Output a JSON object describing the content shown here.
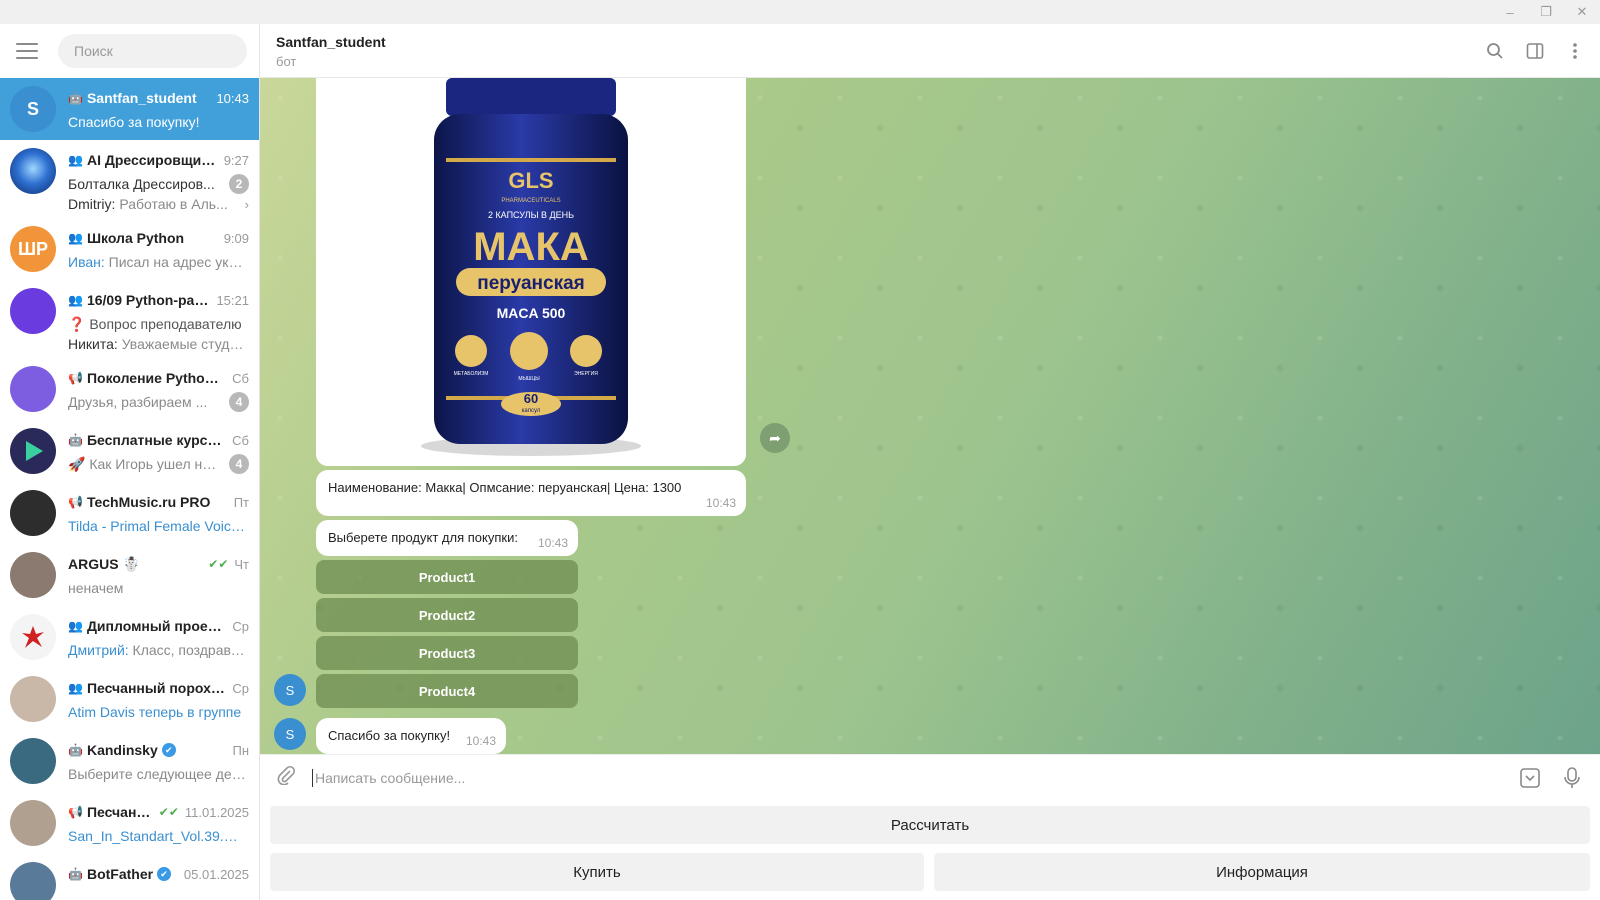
{
  "window": {
    "minimize": "–",
    "restore": "❐",
    "close": "✕"
  },
  "sidebar": {
    "search_placeholder": "Поиск",
    "chats": [
      {
        "type": "🤖",
        "name": "Santfan_student",
        "time": "10:43",
        "message": "Спасибо за покупку!",
        "avatar_letter": "S",
        "avatar_color": "#3a8fd0"
      },
      {
        "type": "👥",
        "name": "AI Дрессировщик...",
        "time": "9:27",
        "message": "Болталка Дрессиров...",
        "badge": "2",
        "avatar_color": "#1f4fa0"
      },
      {
        "type": "👥",
        "name": "Школа Python",
        "time": "9:09",
        "sender": "Иван:",
        "message": "Писал на адрес указа...",
        "avatar_letter": "ШР",
        "avatar_color": "#f2953a"
      },
      {
        "type": "👥",
        "name": "16/09 Python-раз...",
        "time": "15:21",
        "message": "❓ Вопрос преподавателю",
        "avatar_color": "#6a3ce0"
      },
      {
        "type": "📢",
        "name": "Поколение Python 🐍",
        "time": "Сб",
        "message": "Друзья, разбираем ...",
        "badge": "4",
        "avatar_color": "#7d5ee0"
      },
      {
        "type": "🤖",
        "name": "Бесплатные курсы ...",
        "time": "Сб",
        "message": "🚀 Как Игорь ушел на ...",
        "badge": "4",
        "avatar_color": "#2a2a5a"
      },
      {
        "type": "📢",
        "name": "TechMusic.ru PRO",
        "time": "Пт",
        "message": "Tilda - Primal Female Voice 1....",
        "avatar_color": "#2d2d2d"
      },
      {
        "type": "",
        "name": "ARGUS ☃️",
        "time": "Чт",
        "message": "неначем",
        "checks": "✔✔",
        "avatar_color": "#8a7a70"
      },
      {
        "type": "👥",
        "name": "Дипломный проект...",
        "time": "Ср",
        "sender": "Дмитрий:",
        "message": "Класс, поздравля...",
        "avatar_color": "#e8e8e8"
      },
      {
        "type": "👥",
        "name": "Песчанный порох С...",
        "time": "Ср",
        "message": "Atim Davis теперь в группе",
        "avatar_color": "#c9b8a8"
      },
      {
        "type": "🤖",
        "name": "Kandinsky",
        "time": "Пн",
        "message": "Выберите следующее дейст...",
        "verified": "✔",
        "avatar_color": "#3a6a80"
      },
      {
        "type": "📢",
        "name": "Песчанн...",
        "time": "11.01.2025",
        "message": "San_In_Standart_Vol.39.mp3....",
        "checks": "✔✔",
        "avatar_color": "#b0a090"
      },
      {
        "type": "🤖",
        "name": "BotFather",
        "time": "05.01.2025",
        "message": "",
        "verified": "✔",
        "avatar_color": "#5a7a9a"
      }
    ],
    "sub_line_ai": {
      "sender": "Dmitriy:",
      "text": "Работаю в Аль..."
    },
    "sub_line_python": {
      "sender": "Никита:",
      "text": "Уважаемые студен..."
    }
  },
  "header": {
    "title": "Santfan_student",
    "subtitle": "бот"
  },
  "messages": {
    "product_text": "Наименование: Макка| Опмсание: перуанская| Цена: 1300",
    "product_time": "10:43",
    "choose_text": "Выберете продукт для покупки:",
    "choose_time": "10:43",
    "inline_buttons": [
      "Product1",
      "Product2",
      "Product3",
      "Product4"
    ],
    "thanks_text": "Спасибо за покупку!",
    "thanks_time": "10:43",
    "avatar_letter": "S"
  },
  "product_image": {
    "brand": "GLS",
    "brand_sub": "PHARMACEUTICALS",
    "dose": "2 КАПСУЛЫ В ДЕНЬ",
    "title": "МАКА",
    "subtitle": "перуанская",
    "variant": "MACA 500",
    "icon_labels": [
      "МЕТАБОЛИЗМ",
      "МЫШЦЫ",
      "ЭНЕРГИЯ"
    ],
    "count": "60",
    "count_unit": "капсул"
  },
  "composer": {
    "placeholder": "Написать сообщение..."
  },
  "reply_keyboard": {
    "calc": "Рассчитать",
    "buy": "Купить",
    "info": "Информация"
  }
}
